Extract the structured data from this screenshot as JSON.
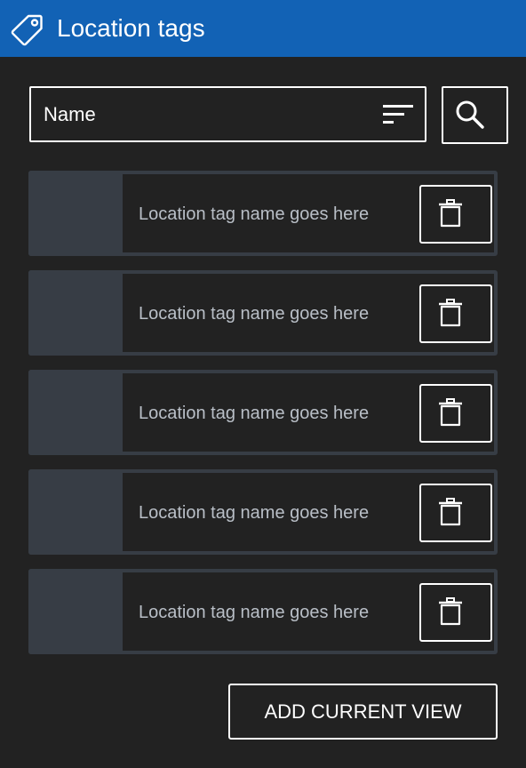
{
  "header": {
    "icon": "tag-icon",
    "title": "Location tags",
    "background": "#1262b5"
  },
  "sort": {
    "label": "Name",
    "icon": "sort-icon"
  },
  "search": {
    "icon": "search-icon"
  },
  "tags": [
    {
      "name": "Location tag name goes here",
      "delete_icon": "trash-icon"
    },
    {
      "name": "Location tag name goes here",
      "delete_icon": "trash-icon"
    },
    {
      "name": "Location tag name goes here",
      "delete_icon": "trash-icon"
    },
    {
      "name": "Location tag name goes here",
      "delete_icon": "trash-icon"
    },
    {
      "name": "Location tag name goes here",
      "delete_icon": "trash-icon"
    }
  ],
  "actions": {
    "add_label": "ADD CURRENT VIEW"
  },
  "colors": {
    "panel_background": "#222222",
    "thumbnail": "#373d45",
    "tag_text": "#b9bfc7",
    "border": "#ffffff"
  }
}
